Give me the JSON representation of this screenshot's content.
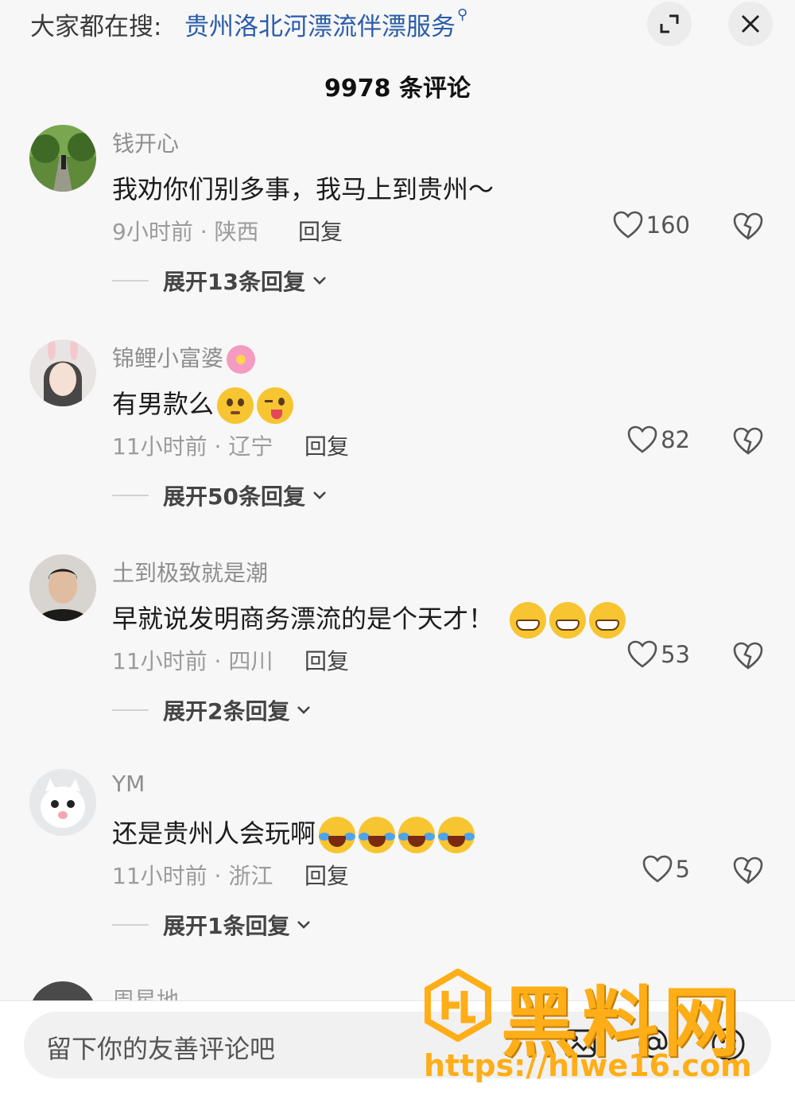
{
  "header": {
    "search_prefix": "大家都在搜:",
    "search_query": "贵州洛北河漂流伴漂服务",
    "comment_count": "9978 条评论"
  },
  "comments": [
    {
      "username": "钱开心",
      "text": "我劝你们别多事，我马上到贵州～",
      "meta": "9小时前 · 陕西",
      "reply_label": "回复",
      "likes": "160",
      "expand_label": "展开13条回复"
    },
    {
      "username": "锦鲤小富婆",
      "text": "有男款么",
      "meta": "11小时前 · 辽宁",
      "reply_label": "回复",
      "likes": "82",
      "expand_label": "展开50条回复"
    },
    {
      "username": "土到极致就是潮",
      "text": "早就说发明商务漂流的是个天才！",
      "meta": "11小时前 · 四川",
      "reply_label": "回复",
      "likes": "53",
      "expand_label": "展开2条回复"
    },
    {
      "username": "YM",
      "text": "还是贵州人会玩啊",
      "meta": "11小时前 · 浙江",
      "reply_label": "回复",
      "likes": "5",
      "expand_label": "展开1条回复"
    }
  ],
  "partial_comment": {
    "username": "周星地"
  },
  "input": {
    "placeholder": "留下你的友善评论吧"
  },
  "watermark": {
    "text": "黑料网",
    "url": "https://hlwe16.com"
  },
  "colors": {
    "search_link": "#2a5caa",
    "watermark": "#ffae17",
    "background": "#f7f7f7"
  }
}
